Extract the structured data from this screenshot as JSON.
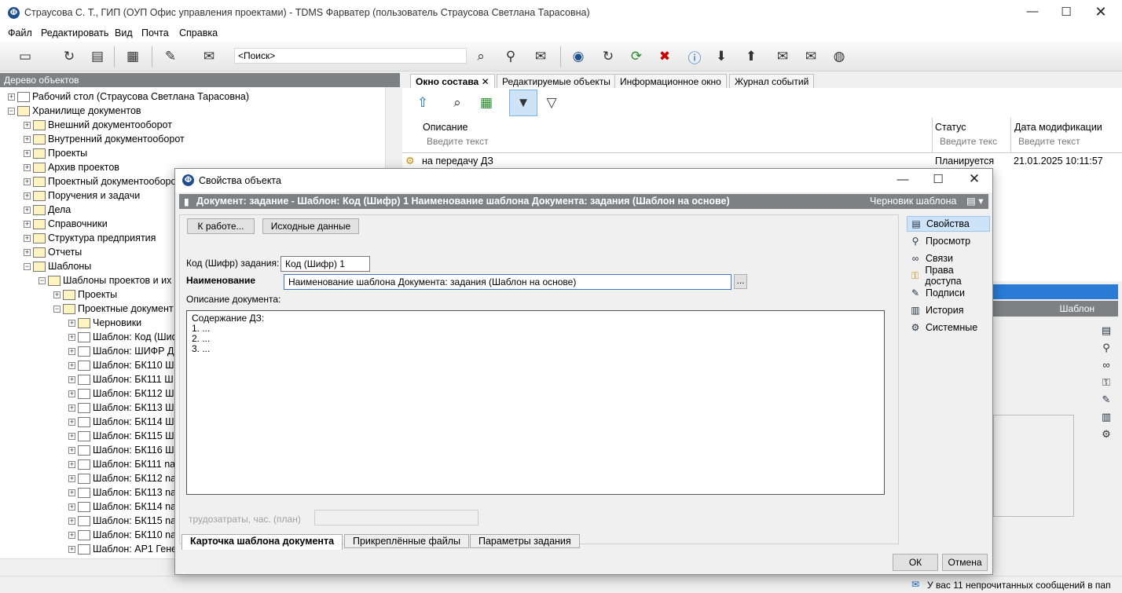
{
  "window": {
    "title": "Страусова С. Т., ГИП (ОУП Офис управления проектами) - TDMS Фарватер (пользователь Страусова Светлана Тарасовна)"
  },
  "menu": [
    "Файл",
    "Редактировать",
    "Вид",
    "Почта",
    "Справка"
  ],
  "search": {
    "value": "<Поиск>"
  },
  "tree": {
    "header": "Дерево объектов",
    "nodes": [
      "Рабочий стол (Страусова Светлана Тарасовна)",
      "Хранилище документов",
      "Внешний документооборот",
      "Внутренний документооборот",
      "Проекты",
      "Архив проектов",
      "Проектный документооборот",
      "Поручения и задачи",
      "Дела",
      "Справочники",
      "Структура предприятия",
      "Отчеты",
      "Шаблоны",
      "Шаблоны проектов и их",
      "Проекты",
      "Проектные документ",
      "Черновики",
      "Шаблон: Код (Шиф",
      "Шаблон: ШИФР Д",
      "Шаблон: БК110  Ш",
      "Шаблон: БК111  Ш",
      "Шаблон: БК112  Ш",
      "Шаблон: БК113  Ш",
      "Шаблон: БК114  Ш",
      "Шаблон: БК115  Ш",
      "Шаблон: БК116  Ш",
      "Шаблон: БК111  na",
      "Шаблон: БК112  na",
      "Шаблон: БК113  na",
      "Шаблон: БК114  na",
      "Шаблон: БК115  na",
      "Шаблон: БК110  na",
      "Шаблон: АР1  Гене"
    ]
  },
  "tabs": [
    "Окно состава",
    "Редактируемые объекты",
    "Информационное окно",
    "Журнал событий"
  ],
  "grid": {
    "columns": [
      "Описание",
      "Статус",
      "Дата модификации"
    ],
    "filter_placeholders": [
      "Введите текст",
      "Введите текс",
      "Введите текст"
    ],
    "row": {
      "description": "на передачу ДЗ",
      "status": "Планируется",
      "date": "21.01.2025 10:11:57"
    }
  },
  "lower_panel": {
    "bar_label": "Шаблон"
  },
  "status": {
    "messages": "У вас 11 непрочитанных сообщений в пап"
  },
  "dialog": {
    "title": "Свойства объекта",
    "header": "Документ: задание - Шаблон: Код (Шифр) 1  Наименование шаблона Документа: задания (Шаблон на основе)",
    "state": "Черновик шаблона",
    "btn_to_work": "К работе...",
    "btn_source": "Исходные данные",
    "code_label": "Код (Шифр) задания:",
    "code_value": "Код (Шифр) 1",
    "name_label": "Наименование",
    "name_value": "Наименование шаблона Документа: задания (Шаблон на основе)",
    "ellipsis": "...",
    "desc_label": "Описание документа:",
    "desc_lines": [
      "Содержание ДЗ:",
      "1. ...",
      "2. ...",
      "3. ..."
    ],
    "labor_label": "трудозатраты, час. (план)",
    "side": [
      "Свойства",
      "Просмотр",
      "Связи",
      "Права доступа",
      "Подписи",
      "История",
      "Системные"
    ],
    "bottom_tabs": [
      "Карточка шаблона документа",
      "Прикреплённые файлы",
      "Параметры задания"
    ],
    "ok": "ОК",
    "cancel": "Отмена"
  }
}
